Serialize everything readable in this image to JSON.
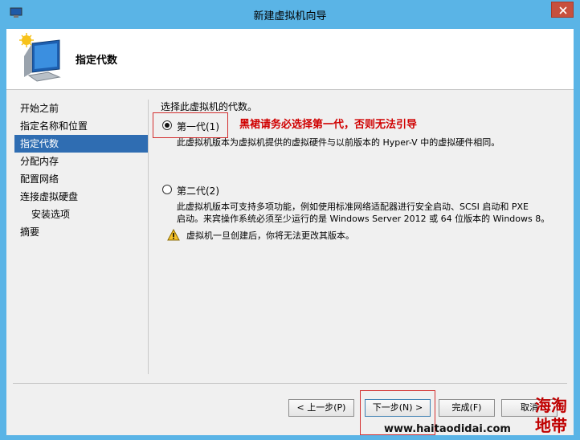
{
  "window": {
    "title": "新建虚拟机向导"
  },
  "header": {
    "title": "指定代数"
  },
  "nav": {
    "items": [
      {
        "label": "开始之前"
      },
      {
        "label": "指定名称和位置"
      },
      {
        "label": "指定代数",
        "active": true
      },
      {
        "label": "分配内存"
      },
      {
        "label": "配置网络"
      },
      {
        "label": "连接虚拟硬盘"
      },
      {
        "label": "安装选项",
        "sub": true
      },
      {
        "label": "摘要"
      }
    ]
  },
  "content": {
    "prompt": "选择此虚拟机的代数。",
    "options": [
      {
        "label": "第一代(1)",
        "selected": true,
        "desc": "此虚拟机版本为虚拟机提供的虚拟硬件与以前版本的 Hyper-V 中的虚拟硬件相同。"
      },
      {
        "label": "第二代(2)",
        "selected": false,
        "desc_line1": "此虚拟机版本可支持多项功能，例如使用标准网络适配器进行安全启动、SCSI 启动和 PXE",
        "desc_line2": "启动。来宾操作系统必须至少运行的是 Windows Server 2012 或 64 位版本的 Windows 8。"
      }
    ],
    "warning": "虚拟机一旦创建后，你将无法更改其版本。",
    "annotation": "黑裙请务必选择第一代，否则无法引导"
  },
  "buttons": {
    "prev": "< 上一步(P)",
    "next": "下一步(N) >",
    "finish": "完成(F)",
    "cancel": "取消"
  },
  "watermark": {
    "url": "www.haitaodidai.com",
    "logo_text": "海淘地带"
  },
  "colors": {
    "titlebar": "#5ab4e6",
    "nav_active": "#2f6db2",
    "annotation": "#d00000",
    "close_button": "#c7503e"
  }
}
